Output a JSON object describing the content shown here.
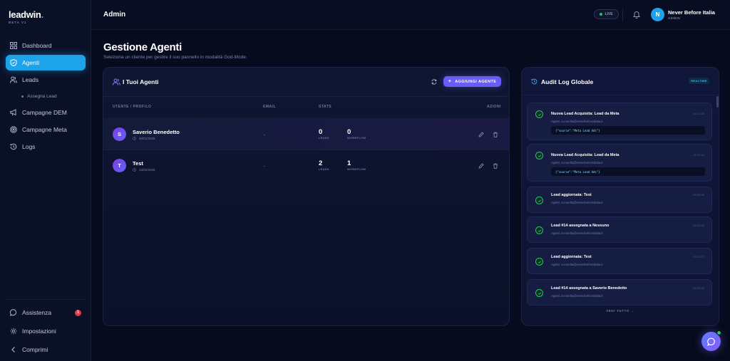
{
  "app": {
    "logo": "leadwin",
    "logo_dot": ".",
    "logo_sub": "BETA V1"
  },
  "sidebar": {
    "items": [
      {
        "label": "Dashboard",
        "icon": "grid-icon"
      },
      {
        "label": "Agenti",
        "icon": "shield-icon",
        "active": true
      },
      {
        "label": "Leads",
        "icon": "users-icon"
      },
      {
        "label": "Assegna Lead",
        "sub": true
      },
      {
        "label": "Campagne DEM",
        "icon": "megaphone-icon"
      },
      {
        "label": "Campagne Meta",
        "icon": "target-icon"
      },
      {
        "label": "Logs",
        "icon": "history-icon"
      }
    ],
    "bottom": {
      "support": "Assistenza",
      "support_badge": "1",
      "settings": "Impostazioni",
      "collapse": "Comprimi"
    }
  },
  "topbar": {
    "page": "Admin",
    "live": "LIVE",
    "user_initial": "N",
    "user_name": "Never Before Italia",
    "user_role": "ADMIN"
  },
  "main": {
    "title": "Gestione Agenti",
    "subtitle": "Seleziona un cliente per gestire il suo pannello in modalità God-Mode."
  },
  "agents_panel": {
    "title": "I Tuoi Agenti",
    "add_button": "AGGIUNGI AGENTE",
    "columns": [
      "UTENTE / PROFILO",
      "EMAIL",
      "STATS",
      "AZIONI"
    ],
    "rows": [
      {
        "initial": "S",
        "name": "Saverio Benedetto",
        "date": "30/01/2025",
        "email": "-",
        "leads": "0",
        "leads_label": "LEADS",
        "workflows": "0",
        "workflows_label": "WORKFLOW"
      },
      {
        "initial": "T",
        "name": "Test",
        "date": "13/02/2025",
        "email": "-",
        "leads": "2",
        "leads_label": "LEADS",
        "workflows": "1",
        "workflows_label": "WORKFLOW"
      }
    ]
  },
  "audit_panel": {
    "title": "Audit Log Globale",
    "badge": "REALTIME",
    "see_all": "VEDI TUTTO →",
    "logs": [
      {
        "title": "Nuova Lead Acquisita: Lead da Meta",
        "agent": "Agent: a.rosella@neverbeforeitalia.it",
        "time": "09:12:38",
        "code": "{\"source\":\"Meta Lead Ads\"}"
      },
      {
        "title": "Nuova Lead Acquisita: Lead da Meta",
        "agent": "Agent: a.rosella@neverbeforeitalia.it",
        "time": "21:03:41",
        "code": "{\"source\":\"Meta Lead Ads\"}"
      },
      {
        "title": "Lead aggiornata: Test",
        "agent": "Agent: a.rosella@neverbeforeitalia.it",
        "time": "09:28:58",
        "code": null
      },
      {
        "title": "Lead #14 assegnata a Nessuno",
        "agent": "Agent: a.rosella@neverbeforeitalia.it",
        "time": "09:20:25",
        "code": null
      },
      {
        "title": "Lead aggiornata: Test",
        "agent": "Agent: a.rosella@neverbeforeitalia.it",
        "time": "09:20:22",
        "code": null
      },
      {
        "title": "Lead #14 assegnata a Saverio Benedetto",
        "agent": "Agent: a.rosella@neverbeforeitalia.it",
        "time": "09:20:18",
        "code": null
      }
    ]
  },
  "colors": {
    "accent": "#1ca3ea",
    "primary_button": "#6a5cf6",
    "success": "#22c55e",
    "danger": "#e53945"
  }
}
